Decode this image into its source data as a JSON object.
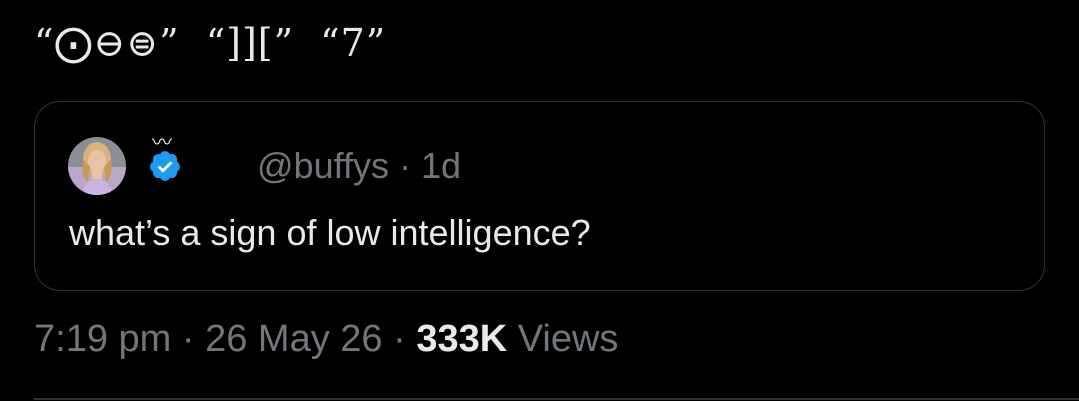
{
  "tweet": {
    "text": "“⨀⊖⊜”  “]][”  “7”"
  },
  "quote": {
    "avatar_icon": "avatar-photo",
    "verified_icon": "verified-badge-icon",
    "verified_color": "#1d9bf0",
    "handle": "@buffys",
    "separator": " · ",
    "time_ago": "1d",
    "body": "what’s a sign of low intelligence?"
  },
  "meta": {
    "time": "7:19 pm",
    "sep1": " · ",
    "date": "26 May 26",
    "sep2": " · ",
    "views_count": "333K",
    "views_label": " Views"
  },
  "colors": {
    "background": "#000000",
    "primary_text": "#e7e9ea",
    "secondary_text": "#71767b",
    "border": "#2f3336"
  }
}
